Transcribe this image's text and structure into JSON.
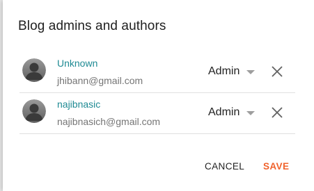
{
  "dialog": {
    "title": "Blog admins and authors",
    "members": [
      {
        "name": "Unknown",
        "email": "jhibann@gmail.com",
        "role": "Admin",
        "icons": {
          "avatar": "default-avatar-icon",
          "role_caret": "chevron-down-icon",
          "remove": "close-icon"
        }
      },
      {
        "name": "najibnasic",
        "email": "najibnasich@gmail.com",
        "role": "Admin",
        "icons": {
          "avatar": "default-avatar-icon",
          "role_caret": "chevron-down-icon",
          "remove": "close-icon"
        }
      }
    ],
    "actions": {
      "cancel_label": "CANCEL",
      "save_label": "SAVE"
    }
  },
  "colors": {
    "name_link": "#1e8a93",
    "save_accent": "#f0622c",
    "email_text": "#757575",
    "divider": "#e0e0e0"
  }
}
